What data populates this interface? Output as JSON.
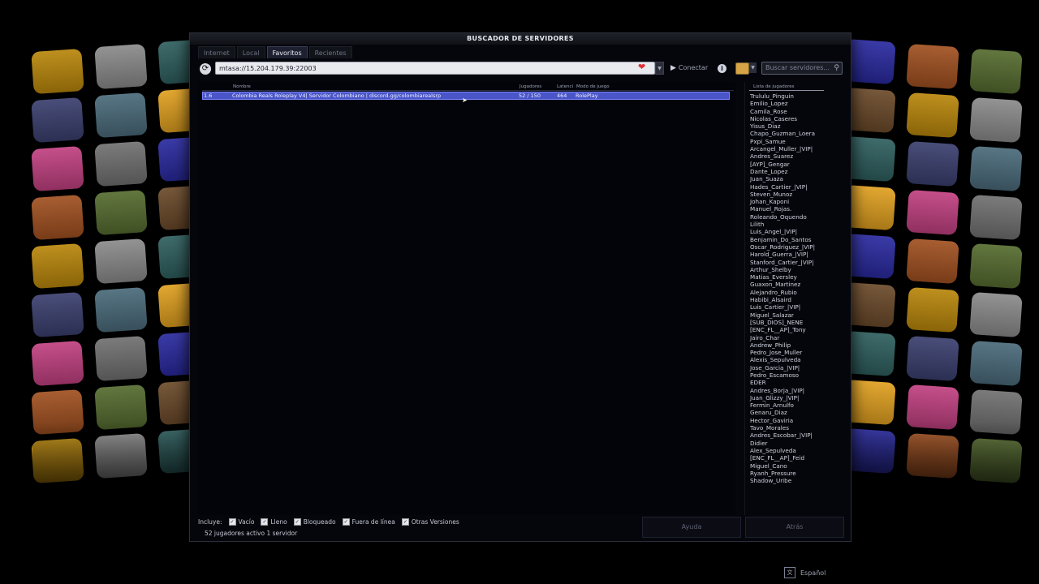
{
  "window": {
    "title": "BUSCADOR DE SERVIDORES"
  },
  "tabs": [
    {
      "label": "Internet",
      "active": false
    },
    {
      "label": "Local",
      "active": false
    },
    {
      "label": "Favoritos",
      "active": true
    },
    {
      "label": "Recientes",
      "active": false
    }
  ],
  "toolbar": {
    "address_value": "mtasa://15.204.179.39:22003",
    "connect_label": "Conectar",
    "search_placeholder": "Buscar servidores..."
  },
  "list": {
    "columns": {
      "name": "Nombre",
      "players": "Jugadores",
      "latency": "Latenci",
      "gamemode": "Modo de juego"
    },
    "rows": [
      {
        "version": "1.6",
        "name": "Colombia Reals Roleplay V4| Servidor Colombiano | discord.gg/colombiarealsrp",
        "players": "52 / 150",
        "latency": "464",
        "gamemode": "RolePlay"
      }
    ]
  },
  "player_list": {
    "header": "Lista de jugadores",
    "players": [
      "Trululu_Pinguin",
      "Emilio_Lopez",
      "Camila_Rose",
      "Nicolas_Caseres",
      "Yisus_Diaz",
      "Chapo_Guzman_Loera",
      "Pxpi_Samue",
      "Arcangel_Muller_|VIP|",
      "Andres_Suarez",
      "[AYP]_Gengar",
      "Dante_Lopez",
      "Juan_Suaza",
      "Hades_Cartier_|VIP|",
      "Steven_Munoz",
      "Johan_Kaponi",
      "Manuel_Rojas.",
      "Roleando_Oquendo",
      "Lilith",
      "Luis_Angel_|VIP|",
      "Benjamin_Do_Santos",
      "Oscar_Rodriguez_|VIP|",
      "Harold_Guerra_|VIP|",
      "Stanford_Cartier_|VIP|",
      "Arthur_Shelby",
      "Matias_Eversley",
      "Guaxon_Martinez",
      "Alejandro_Rubio",
      "Habibi_Alsaird",
      "Luis_Cartier_|VIP|",
      "Miguel_Salazar",
      "[SUB_DIOS]_NENE",
      "[ENC_FL__AP]_Tony",
      "Jairo_Char",
      "Andrew_Philip",
      "Pedro_Jose_Muller",
      "Alexis_Sepulveda",
      "Jose_Garcia_|VIP|",
      "Pedro_Escamoso",
      "EDER",
      "Andres_Borja_|VIP|",
      "Juan_Glizzy_|VIP|",
      "Fermin_Arnulfo",
      "Genaru_Diaz",
      "Hector_Gaviria",
      "Tavo_Morales",
      "Andres_Escobar_|VIP|",
      "Didier",
      "Alex_Sepulveda",
      "[ENC_FL__AP]_Feid",
      "Miguel_Cano",
      "Ryanh_Pressure",
      "Shadow_Uribe"
    ]
  },
  "bottom": {
    "includes_label": "Incluye:",
    "filters": [
      {
        "label": "Vacío",
        "checked": true
      },
      {
        "label": "Lleno",
        "checked": true
      },
      {
        "label": "Bloqueado",
        "checked": true
      },
      {
        "label": "Fuera de línea",
        "checked": true
      },
      {
        "label": "Otras Versiones",
        "checked": true
      }
    ],
    "status": "52 jugadores activo 1 servidor",
    "help_label": "Ayuda",
    "back_label": "Atrás"
  },
  "language": "Español",
  "colors": {
    "selection": "#4a55c8",
    "favorite": "#e0303a",
    "background": "#05060b"
  }
}
